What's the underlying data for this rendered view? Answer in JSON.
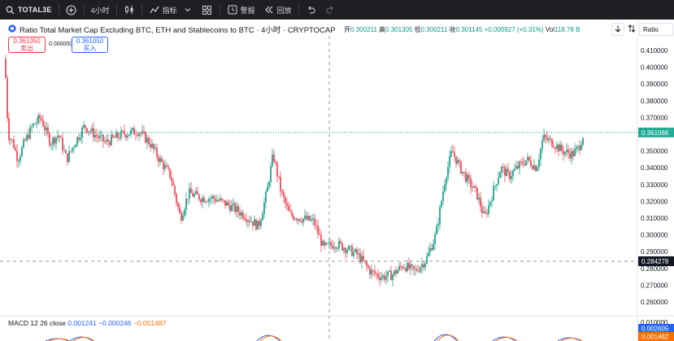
{
  "toolbar": {
    "symbol": "TOTAL3E",
    "interval": "4小时",
    "indicators_label": "指标",
    "alert_label": "警报",
    "replay_label": "回放"
  },
  "legend": {
    "title": "Ratio Total Market Cap Excluding BTC, ETH and Stablecoins to BTC · 4小时 · CRYPTOCAP",
    "open_label": "开",
    "open": "0.300211",
    "high_label": "高",
    "high": "0.301305",
    "low_label": "低",
    "low": "0.300211",
    "close_label": "收",
    "close": "0.301145",
    "change": "+0.000927 (+0.31%)",
    "vol_label": "Vol",
    "vol": "118.78 B"
  },
  "trade": {
    "sell_price": "0.361050",
    "sell_label": "卖出",
    "spread": "0.000000",
    "buy_price": "0.361050",
    "buy_label": "买入"
  },
  "scale_mode": "Ratio",
  "macd": {
    "label": "MACD 12 26 close",
    "macd": "0.001241",
    "signal": "−0.000246",
    "hist": "−0.001487",
    "badge_blue": "0.002605",
    "badge_orange": "0.001462",
    "axis_top": "0.010000"
  },
  "price_axis": {
    "ticks": [
      "0.410000",
      "0.400000",
      "0.390000",
      "0.380000",
      "0.370000",
      "0.360000",
      "0.350000",
      "0.340000",
      "0.330000",
      "0.320000",
      "0.310000",
      "0.300000",
      "0.290000",
      "0.280000",
      "0.270000",
      "0.260000"
    ],
    "current_price": "0.361066",
    "crosshair_price": "0.284278"
  },
  "colors": {
    "up": "#089981",
    "down": "#f23645",
    "toolbar_bg": "#1e1f23",
    "price_badge": "#22ab94",
    "crosshair_badge": "#131722"
  }
}
